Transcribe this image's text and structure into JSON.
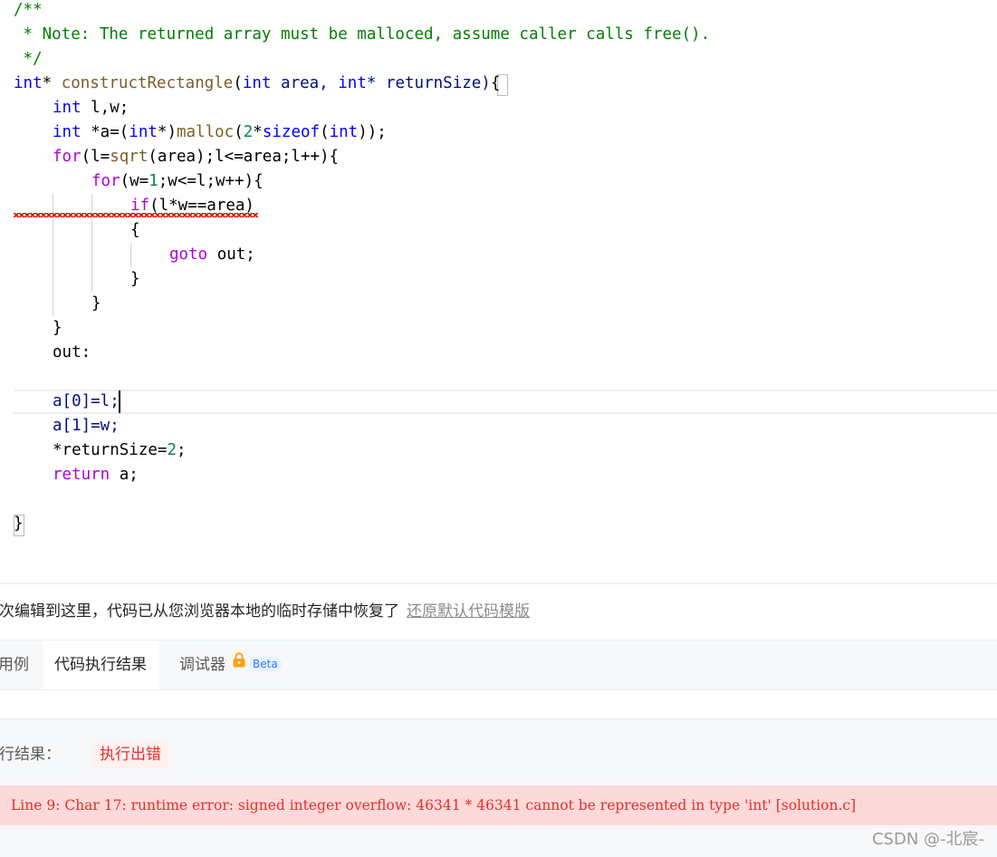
{
  "editor": {
    "code": {
      "l1": "/**",
      "l2": " * Note: The returned array must be malloced, assume caller calls free().",
      "l3": " */",
      "l4_type": "int",
      "l4_star": "* ",
      "l4_fn": "constructRectangle",
      "l4_p1": "(",
      "l4_int1": "int",
      "l4_area": " area, ",
      "l4_int2": "int",
      "l4_rest": "* returnSize)",
      "l4_brace": "{",
      "l5_int": "int",
      "l5_rest": " l,w;",
      "l6_int": "int",
      "l6_a": " *a=(",
      "l6_int2": "int",
      "l6_cast": "*)",
      "l6_malloc": "malloc",
      "l6_p": "(",
      "l6_two": "2",
      "l6_star": "*",
      "l6_sizeof": "sizeof",
      "l6_p2": "(",
      "l6_int3": "int",
      "l6_end": "));",
      "l7_for": "for",
      "l7_a": "(l=",
      "l7_sqrt": "sqrt",
      "l7_rest": "(area);l<=area;l++){",
      "l8_for": "for",
      "l8_a": "(w=",
      "l8_one": "1",
      "l8_rest": ";w<=l;w++){",
      "l9_if": "if",
      "l9_rest": "(l*w==area)",
      "l10": "{",
      "l11_goto": "goto",
      "l11_rest": " out;",
      "l12": "}",
      "l13": "}",
      "l14": "}",
      "l15": "out:",
      "l17": "a[0]=l;",
      "l18": "a[1]=w;",
      "l19_a": "*returnSize=",
      "l19_two": "2",
      "l19_end": ";",
      "l20_return": "return",
      "l20_rest": " a;",
      "l22": "}"
    }
  },
  "restore": {
    "message": "上次编辑到这里，代码已从您浏览器本地的临时存储中恢复了",
    "link": "还原默认代码模版"
  },
  "tabs": [
    {
      "label": "测试用例"
    },
    {
      "label": "代码执行结果"
    },
    {
      "label": "调试器"
    }
  ],
  "beta_badge": "Beta",
  "result": {
    "label": "执行结果：",
    "status": "执行出错",
    "error": "Line 9: Char 17: runtime error: signed integer overflow: 46341 * 46341 cannot be represented in type 'int' [solution.c]"
  },
  "watermark": "CSDN @-北宸-",
  "colors": {
    "keyword": "#0000ff",
    "control": "#af00db",
    "function": "#795e26",
    "number": "#098658",
    "comment": "#008000",
    "error": "#e4302b"
  }
}
